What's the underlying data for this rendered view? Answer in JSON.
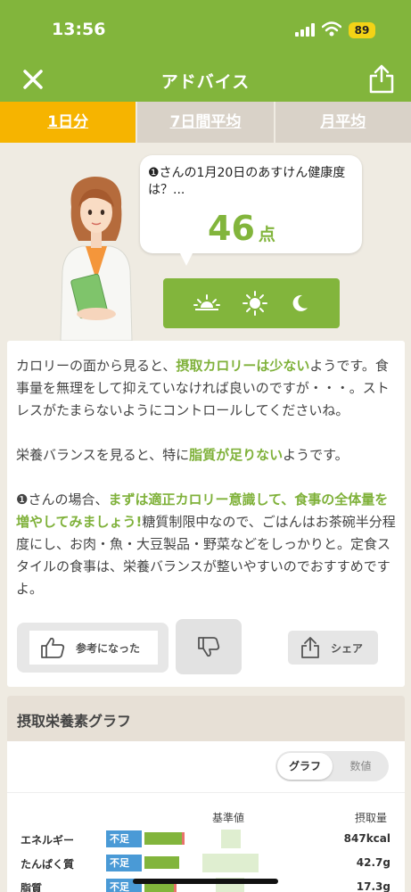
{
  "status_bar": {
    "time": "13:56",
    "battery": "89"
  },
  "nav": {
    "title": "アドバイス"
  },
  "tabs": [
    {
      "label": "1日分"
    },
    {
      "label": "7日間平均"
    },
    {
      "label": "月平均"
    }
  ],
  "hero": {
    "question": "❶さんの1月20日のあすけん健康度は？...",
    "score": "46",
    "score_unit": "点"
  },
  "advice": {
    "p1_a": "カロリーの面から見ると、",
    "p1_hl": "摂取カロリーは少ない",
    "p1_b": "ようです。食事量を無理をして抑えていなければ良いのですが・・・。ストレスがたまらないようにコントロールしてくださいね。",
    "p2_a": "栄養バランスを見ると、特に",
    "p2_hl": "脂質が足りない",
    "p2_b": "ようです。",
    "p3_a": "❶さんの場合、",
    "p3_hl": "まずは適正カロリー意識して、食事の全体量を増やしてみましょう!",
    "p3_b": "糖質制限中なので、ごはんはお茶碗半分程度にし、お肉・魚・大豆製品・野菜などをしっかりと。定食スタイルの食事は、栄養バランスが整いやすいのでおすすめですよ。",
    "like_label": "参考になった",
    "share_label": "シェア"
  },
  "graph": {
    "title": "摂取栄養素グラフ",
    "toggle_graph": "グラフ",
    "toggle_value": "数値",
    "col_ref": "基準値",
    "col_intake": "摂取量",
    "rows": [
      {
        "name": "エネルギー",
        "status": "不足",
        "value": "847kcal",
        "fill": 0.42
      },
      {
        "name": "たんぱく質",
        "status": "不足",
        "value": "42.7g",
        "fill": 0.39
      },
      {
        "name": "脂質",
        "status": "不足",
        "value": "17.3g",
        "fill": 0.33
      }
    ]
  },
  "colors": {
    "brand_green": "#82b53c",
    "tab_active": "#f6b400",
    "badge_blue": "#4a9ad6"
  }
}
